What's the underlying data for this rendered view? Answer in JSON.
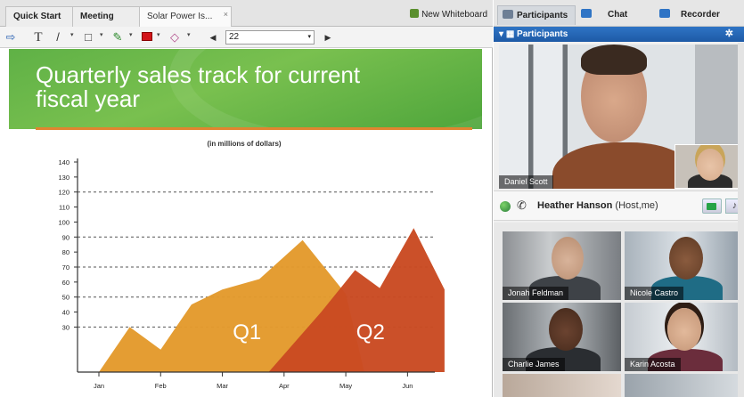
{
  "tabs": {
    "items": [
      {
        "label": "Quick Start"
      },
      {
        "label": "Meeting Info"
      },
      {
        "label": "Solar Power Is..."
      }
    ],
    "close_glyph": "×",
    "new_whiteboard": "New Whiteboard"
  },
  "toolbar": {
    "zoom_value": "22",
    "dropdown_arrow": "▾"
  },
  "slide": {
    "title": "Quarterly sales track for current fiscal year"
  },
  "chart_data": {
    "type": "area",
    "subtitle": "(in millions of dollars)",
    "y_ticks": [
      30,
      40,
      50,
      60,
      70,
      80,
      90,
      100,
      110,
      120,
      130,
      140
    ],
    "ylim": [
      0,
      140
    ],
    "dashed_gridlines": [
      30,
      50,
      70,
      90,
      120
    ],
    "x_ticks": [
      "Jan",
      "Feb",
      "Mar",
      "Apr",
      "May",
      "Jun"
    ],
    "series": [
      {
        "name": "Q1",
        "color": "#e39a2c",
        "points": [
          [
            0.0,
            0
          ],
          [
            0.5,
            30
          ],
          [
            1.0,
            15
          ],
          [
            1.5,
            45
          ],
          [
            2.0,
            55
          ],
          [
            2.6,
            62
          ],
          [
            3.3,
            88
          ],
          [
            4.0,
            52
          ],
          [
            4.3,
            0
          ]
        ]
      },
      {
        "name": "Q2",
        "color": "#c94a22",
        "points": [
          [
            2.75,
            0
          ],
          [
            3.6,
            40
          ],
          [
            4.15,
            68
          ],
          [
            4.55,
            56
          ],
          [
            5.1,
            96
          ],
          [
            5.6,
            55
          ],
          [
            5.6,
            0
          ]
        ]
      }
    ],
    "grid": true
  },
  "right_tabs": {
    "items": [
      {
        "label": "Participants"
      },
      {
        "label": "Chat"
      },
      {
        "label": "Recorder"
      }
    ]
  },
  "participants_panel": {
    "header": "Participants",
    "main_video_name": "Daniel Scott",
    "host_name": "Heather Hanson",
    "host_role": "(Host,me)",
    "tiles": [
      {
        "name": "Jonah Feldman"
      },
      {
        "name": "Nicole Castro"
      },
      {
        "name": "Charlie James"
      },
      {
        "name": "Karin Acosta"
      }
    ]
  },
  "colors": {
    "accent_blue": "#2464b4",
    "banner_green": "#5fb146",
    "q1_orange": "#e39a2c",
    "q2_red": "#c94a22"
  }
}
